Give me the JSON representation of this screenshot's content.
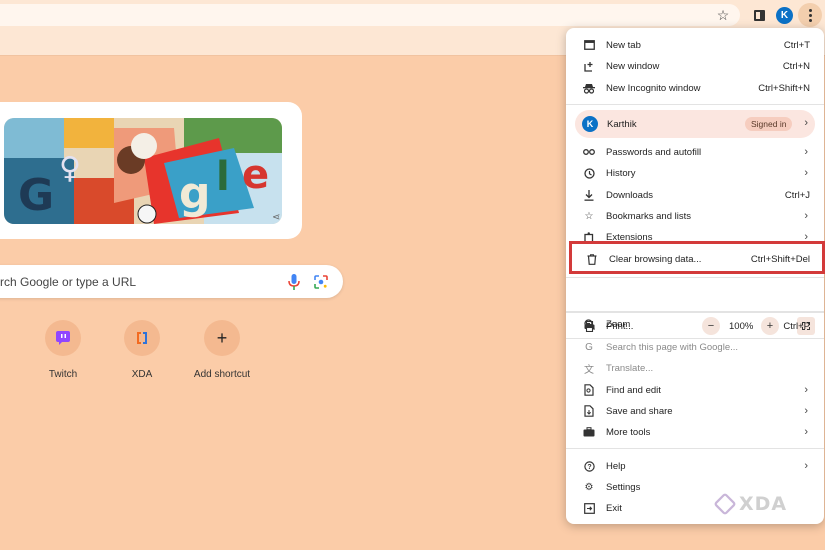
{
  "toolbar": {
    "profile_initial": "K"
  },
  "search": {
    "placeholder_visible": "rch Google or type a URL"
  },
  "shortcuts": [
    {
      "label": "Twitch",
      "icon": "twitch-icon"
    },
    {
      "label": "XDA",
      "icon": "xda-icon"
    },
    {
      "label": "Add shortcut",
      "icon": "plus-icon"
    }
  ],
  "menu": {
    "new_tab": {
      "label": "New tab",
      "shortcut": "Ctrl+T"
    },
    "new_window": {
      "label": "New window",
      "shortcut": "Ctrl+N"
    },
    "new_incognito": {
      "label": "New Incognito window",
      "shortcut": "Ctrl+Shift+N"
    },
    "profile": {
      "initial": "K",
      "name": "Karthik",
      "status": "Signed in"
    },
    "passwords": {
      "label": "Passwords and autofill"
    },
    "history": {
      "label": "History"
    },
    "downloads": {
      "label": "Downloads",
      "shortcut": "Ctrl+J"
    },
    "bookmarks": {
      "label": "Bookmarks and lists"
    },
    "extensions": {
      "label": "Extensions"
    },
    "clear_data": {
      "label": "Clear browsing data...",
      "shortcut": "Ctrl+Shift+Del"
    },
    "zoom": {
      "label": "Zoom",
      "minus": "−",
      "value": "100%",
      "plus": "+"
    },
    "print": {
      "label": "Print...",
      "shortcut": "Ctrl+P"
    },
    "search_page": {
      "label": "Search this page with Google..."
    },
    "translate": {
      "label": "Translate..."
    },
    "find_edit": {
      "label": "Find and edit"
    },
    "save_share": {
      "label": "Save and share"
    },
    "more_tools": {
      "label": "More tools"
    },
    "help": {
      "label": "Help"
    },
    "settings": {
      "label": "Settings"
    },
    "exit": {
      "label": "Exit"
    }
  },
  "watermark": {
    "text": "XDA"
  },
  "colors": {
    "page_bg": "#fbcca8",
    "highlight": "#d33a3a",
    "avatar": "#0b71c6"
  }
}
